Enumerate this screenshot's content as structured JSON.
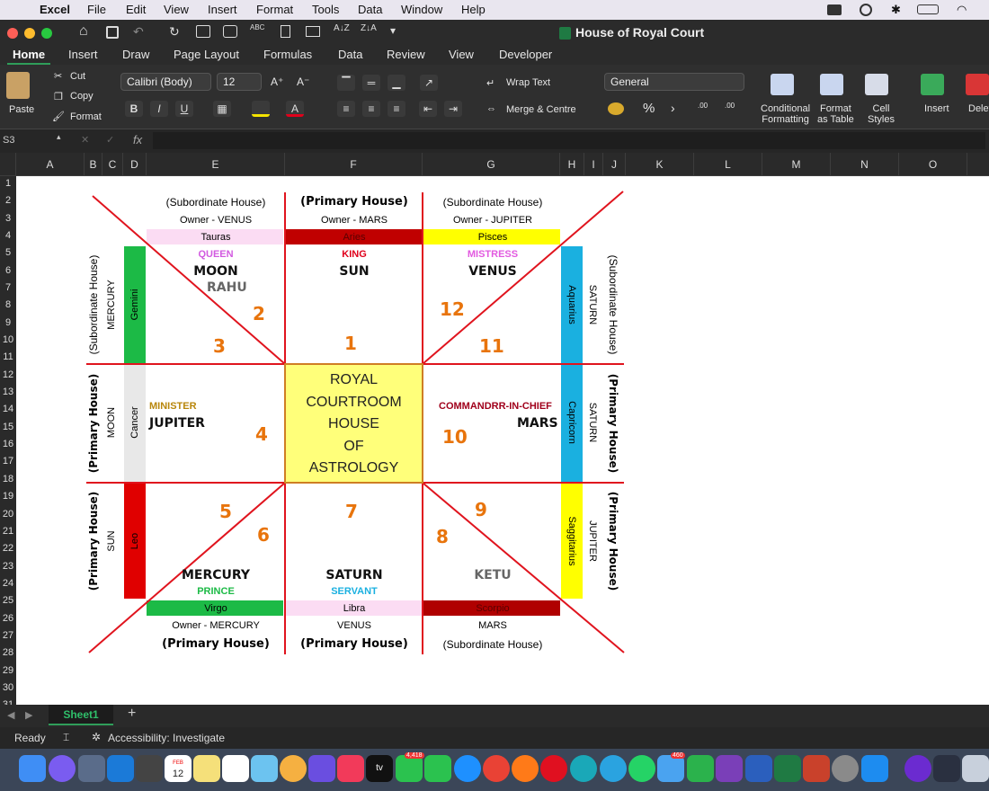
{
  "menubar": {
    "app": "Excel",
    "items": [
      "File",
      "Edit",
      "View",
      "Insert",
      "Format",
      "Tools",
      "Data",
      "Window",
      "Help"
    ]
  },
  "window": {
    "title": "House of Royal Court"
  },
  "ribbon": {
    "tabs": [
      "Home",
      "Insert",
      "Draw",
      "Page Layout",
      "Formulas",
      "Data",
      "Review",
      "View",
      "Developer"
    ],
    "paste": "Paste",
    "cut": "Cut",
    "copy": "Copy",
    "format": "Format",
    "font": "Calibri (Body)",
    "size": "12",
    "wrap": "Wrap Text",
    "merge": "Merge & Centre",
    "numfmt": "General",
    "cond": [
      "Conditional",
      "Formatting"
    ],
    "fat": [
      "Format",
      "as Table"
    ],
    "cell": [
      "Cell",
      "Styles"
    ],
    "insert": "Insert",
    "delete": "Delete"
  },
  "formula_bar": {
    "cell_ref": "S3",
    "fx": "fx"
  },
  "columns": [
    "A",
    "B",
    "C",
    "D",
    "E",
    "F",
    "G",
    "H",
    "I",
    "J",
    "K",
    "L",
    "M",
    "N",
    "O"
  ],
  "rows": [
    "1",
    "2",
    "3",
    "4",
    "5",
    "6",
    "7",
    "8",
    "9",
    "10",
    "11",
    "12",
    "13",
    "14",
    "15",
    "16",
    "17",
    "18",
    "19",
    "20",
    "21",
    "22",
    "23",
    "24",
    "25",
    "26",
    "27",
    "28",
    "29",
    "30",
    "31"
  ],
  "chart": {
    "top": {
      "h1": "(Subordinate House)",
      "h2": "(Primary House)",
      "h3": "(Subordinate House)",
      "o1": "Owner - VENUS",
      "o2": "Owner - MARS",
      "o3": "Owner - JUPITER",
      "s1": "Tauras",
      "s2": "Aries",
      "s3": "Pisces"
    },
    "bottom": {
      "s1": "Virgo",
      "s2": "Libra",
      "s3": "Scorpio",
      "o1": "Owner - MERCURY",
      "o2": "VENUS",
      "o3": "MARS",
      "h1": "(Primary House)",
      "h2": "(Primary House)",
      "h3": "(Subordinate House)"
    },
    "left": {
      "house1": "(Subordinate House)",
      "owner1": "MERCURY",
      "sign1": "Gemini",
      "house2": "(Primary House)",
      "owner2": "MOON",
      "sign2": "Cancer",
      "house3": "(Primary House)",
      "owner3": "SUN",
      "sign3": "Leo"
    },
    "right": {
      "house1": "(Subordinate House)",
      "owner1": "SATURN",
      "sign1": "Aquarius",
      "house2": "(Primary House)",
      "owner2": "SATURN",
      "sign2": "Capricorn",
      "house3": "(Primary House)",
      "owner3": "JUPITER",
      "sign3": "Saggitarius"
    },
    "roles": {
      "queen": "QUEEN",
      "king": "KING",
      "mistress": "MISTRESS",
      "minister": "MINISTER",
      "commander": "COMMANDRR-IN-CHIEF",
      "prince": "PRINCE",
      "servant": "SERVANT"
    },
    "planets": {
      "moon": "MOON",
      "rahu": "RAHU",
      "sun": "SUN",
      "venus": "VENUS",
      "jupiter": "JUPITER",
      "mars": "MARS",
      "mercury": "MERCURY",
      "saturn": "SATURN",
      "ketu": "KETU"
    },
    "houses": {
      "n1": "1",
      "n2": "2",
      "n3": "3",
      "n4": "4",
      "n5": "5",
      "n6": "6",
      "n7": "7",
      "n8": "8",
      "n9": "9",
      "n10": "10",
      "n11": "11",
      "n12": "12"
    },
    "center": [
      "ROYAL",
      "COURTROOM",
      "HOUSE",
      "OF",
      "ASTROLOGY"
    ]
  },
  "sheet_tab": "Sheet1",
  "status": {
    "ready": "Ready",
    "accessibility": "Accessibility: Investigate"
  },
  "dock_badges": {
    "calendar_month": "FEB",
    "calendar_day": "12",
    "messages": "4,418",
    "mail": "460"
  }
}
